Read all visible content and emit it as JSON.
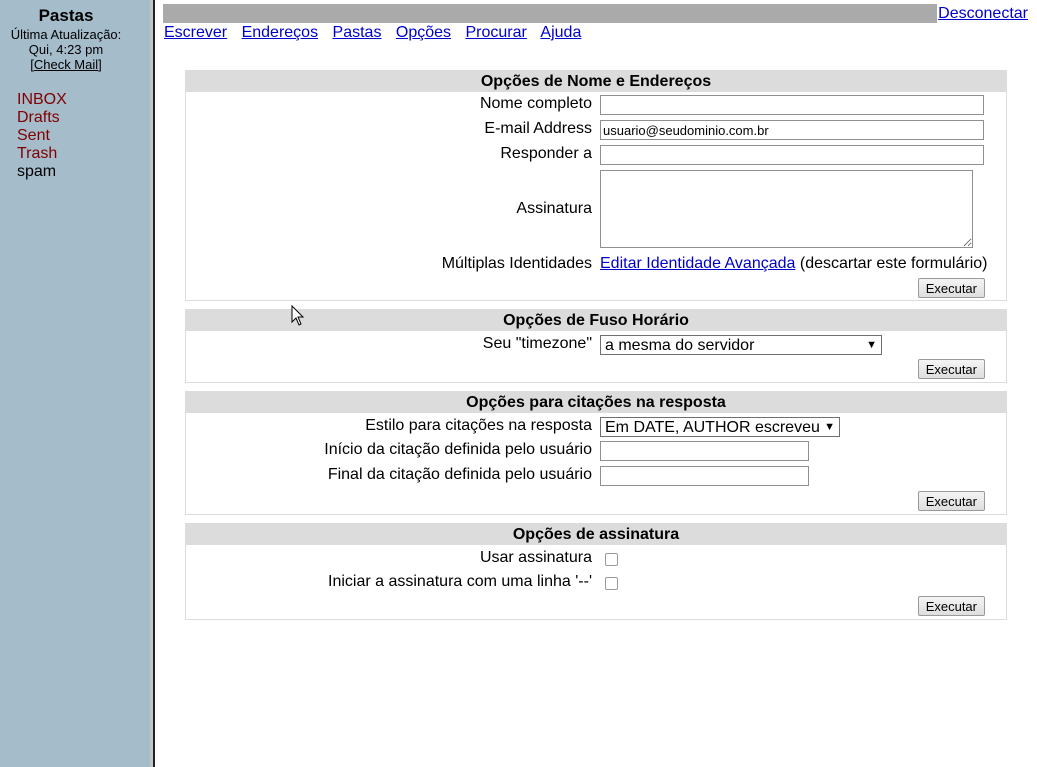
{
  "sidebar": {
    "title": "Pastas",
    "last_update_label": "Última Atualização:",
    "last_update_time": "Qui, 4:23 pm",
    "check_mail": "Check Mail",
    "folders": [
      "INBOX",
      "Drafts",
      "Sent",
      "Trash",
      "spam"
    ]
  },
  "topbar": {
    "logout": "Desconectar"
  },
  "nav": [
    "Escrever",
    "Endereços",
    "Pastas",
    "Opções",
    "Procurar",
    "Ajuda"
  ],
  "name_section": {
    "title": "Opções de Nome e Endereços",
    "fullname_label": "Nome completo",
    "fullname_value": "",
    "email_label": "E-mail Address",
    "email_value": "usuario@seudominio.com.br",
    "replyto_label": "Responder a",
    "replyto_value": "",
    "signature_label": "Assinatura",
    "signature_value": "",
    "identities_label": "Múltiplas Identidades",
    "identities_link": "Editar Identidade Avançada",
    "identities_note": "(descartar este formulário)",
    "submit": "Executar"
  },
  "timezone_section": {
    "title": "Opções de Fuso Horário",
    "tz_label": "Seu \"timezone\"",
    "tz_value": "a mesma do servidor",
    "submit": "Executar"
  },
  "reply_section": {
    "title": "Opções para citações na resposta",
    "style_label": "Estilo para citações na resposta",
    "style_value": "Em DATE, AUTHOR escreveu",
    "start_label": "Início da citação definida pelo usuário",
    "start_value": "",
    "end_label": "Final da citação definida pelo usuário",
    "end_value": "",
    "submit": "Executar"
  },
  "signature_section": {
    "title": "Opções de assinatura",
    "use_label": "Usar assinatura",
    "use_checked": false,
    "dashes_label": "Iniciar a assinatura com uma linha '--'",
    "dashes_checked": false,
    "submit": "Executar"
  },
  "colors": {
    "sidebar_bg": "#a5bccb",
    "section_header": "#dcdcdc",
    "link": "#0000cc",
    "folder": "#800000"
  }
}
